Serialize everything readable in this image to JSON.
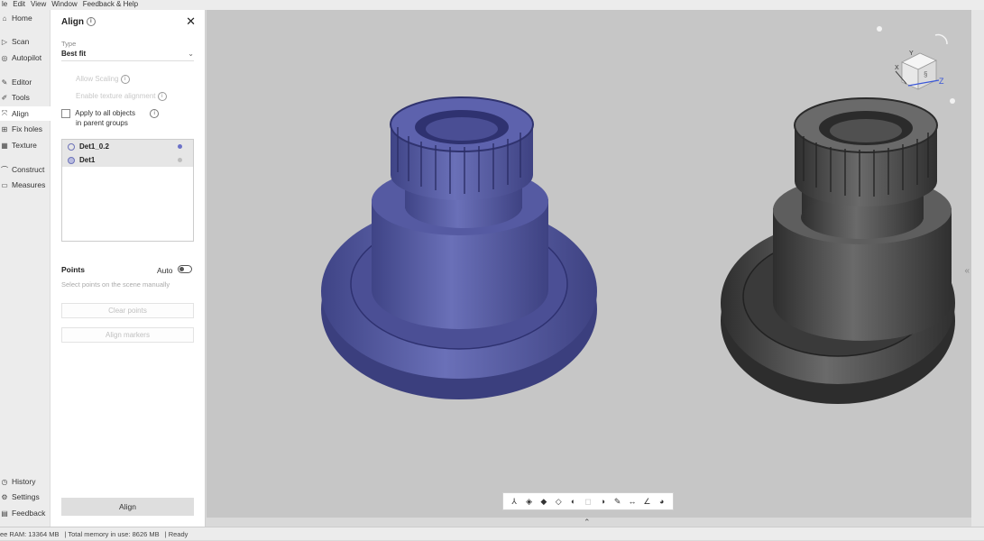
{
  "menu": [
    "le",
    "Edit",
    "View",
    "Window",
    "Feedback & Help"
  ],
  "nav": {
    "top": [
      {
        "label": "Home",
        "icon": "home-icon"
      },
      {
        "label": "Scan",
        "icon": "scan-icon"
      },
      {
        "label": "Autopilot",
        "icon": "autopilot-icon"
      },
      {
        "label": "Editor",
        "icon": "editor-icon"
      },
      {
        "label": "Tools",
        "icon": "tools-icon"
      },
      {
        "label": "Align",
        "icon": "align-icon"
      },
      {
        "label": "Fix holes",
        "icon": "fix-holes-icon"
      },
      {
        "label": "Texture",
        "icon": "texture-icon"
      },
      {
        "label": "Construct",
        "icon": "construct-icon"
      },
      {
        "label": "Measures",
        "icon": "measures-icon"
      }
    ],
    "bottom": [
      {
        "label": "History",
        "icon": "history-icon"
      },
      {
        "label": "Settings",
        "icon": "settings-icon"
      },
      {
        "label": "Feedback",
        "icon": "feedback-icon"
      }
    ],
    "active": "Align"
  },
  "panel": {
    "title": "Align",
    "type_label": "Type",
    "type_value": "Best fit",
    "allow_scaling": "Allow Scaling",
    "enable_texture": "Enable texture alignment",
    "apply_all_line1": "Apply to all objects",
    "apply_all_line2": "in parent groups",
    "objects": [
      {
        "name": "Det1_0.2",
        "dot_color": "#6c72c8"
      },
      {
        "name": "Det1",
        "dot_color": "#bdbdbd"
      }
    ],
    "points_label": "Points",
    "auto_label": "Auto",
    "points_hint": "Select points on the scene manually",
    "clear_points": "Clear points",
    "align_markers": "Align markers",
    "align_button": "Align"
  },
  "viewcube": {
    "face_label": "§",
    "y_label": "Y",
    "x_label": "X",
    "z_label": "Z"
  },
  "status": {
    "free_ram": "ee RAM: 13364 MB",
    "total_memory": "Total memory in use: 8626 MB",
    "state": "Ready"
  },
  "colors": {
    "blue_part": "#5a5fa8",
    "gray_part": "#585858",
    "viewport_bg": "#c6c6c6"
  }
}
